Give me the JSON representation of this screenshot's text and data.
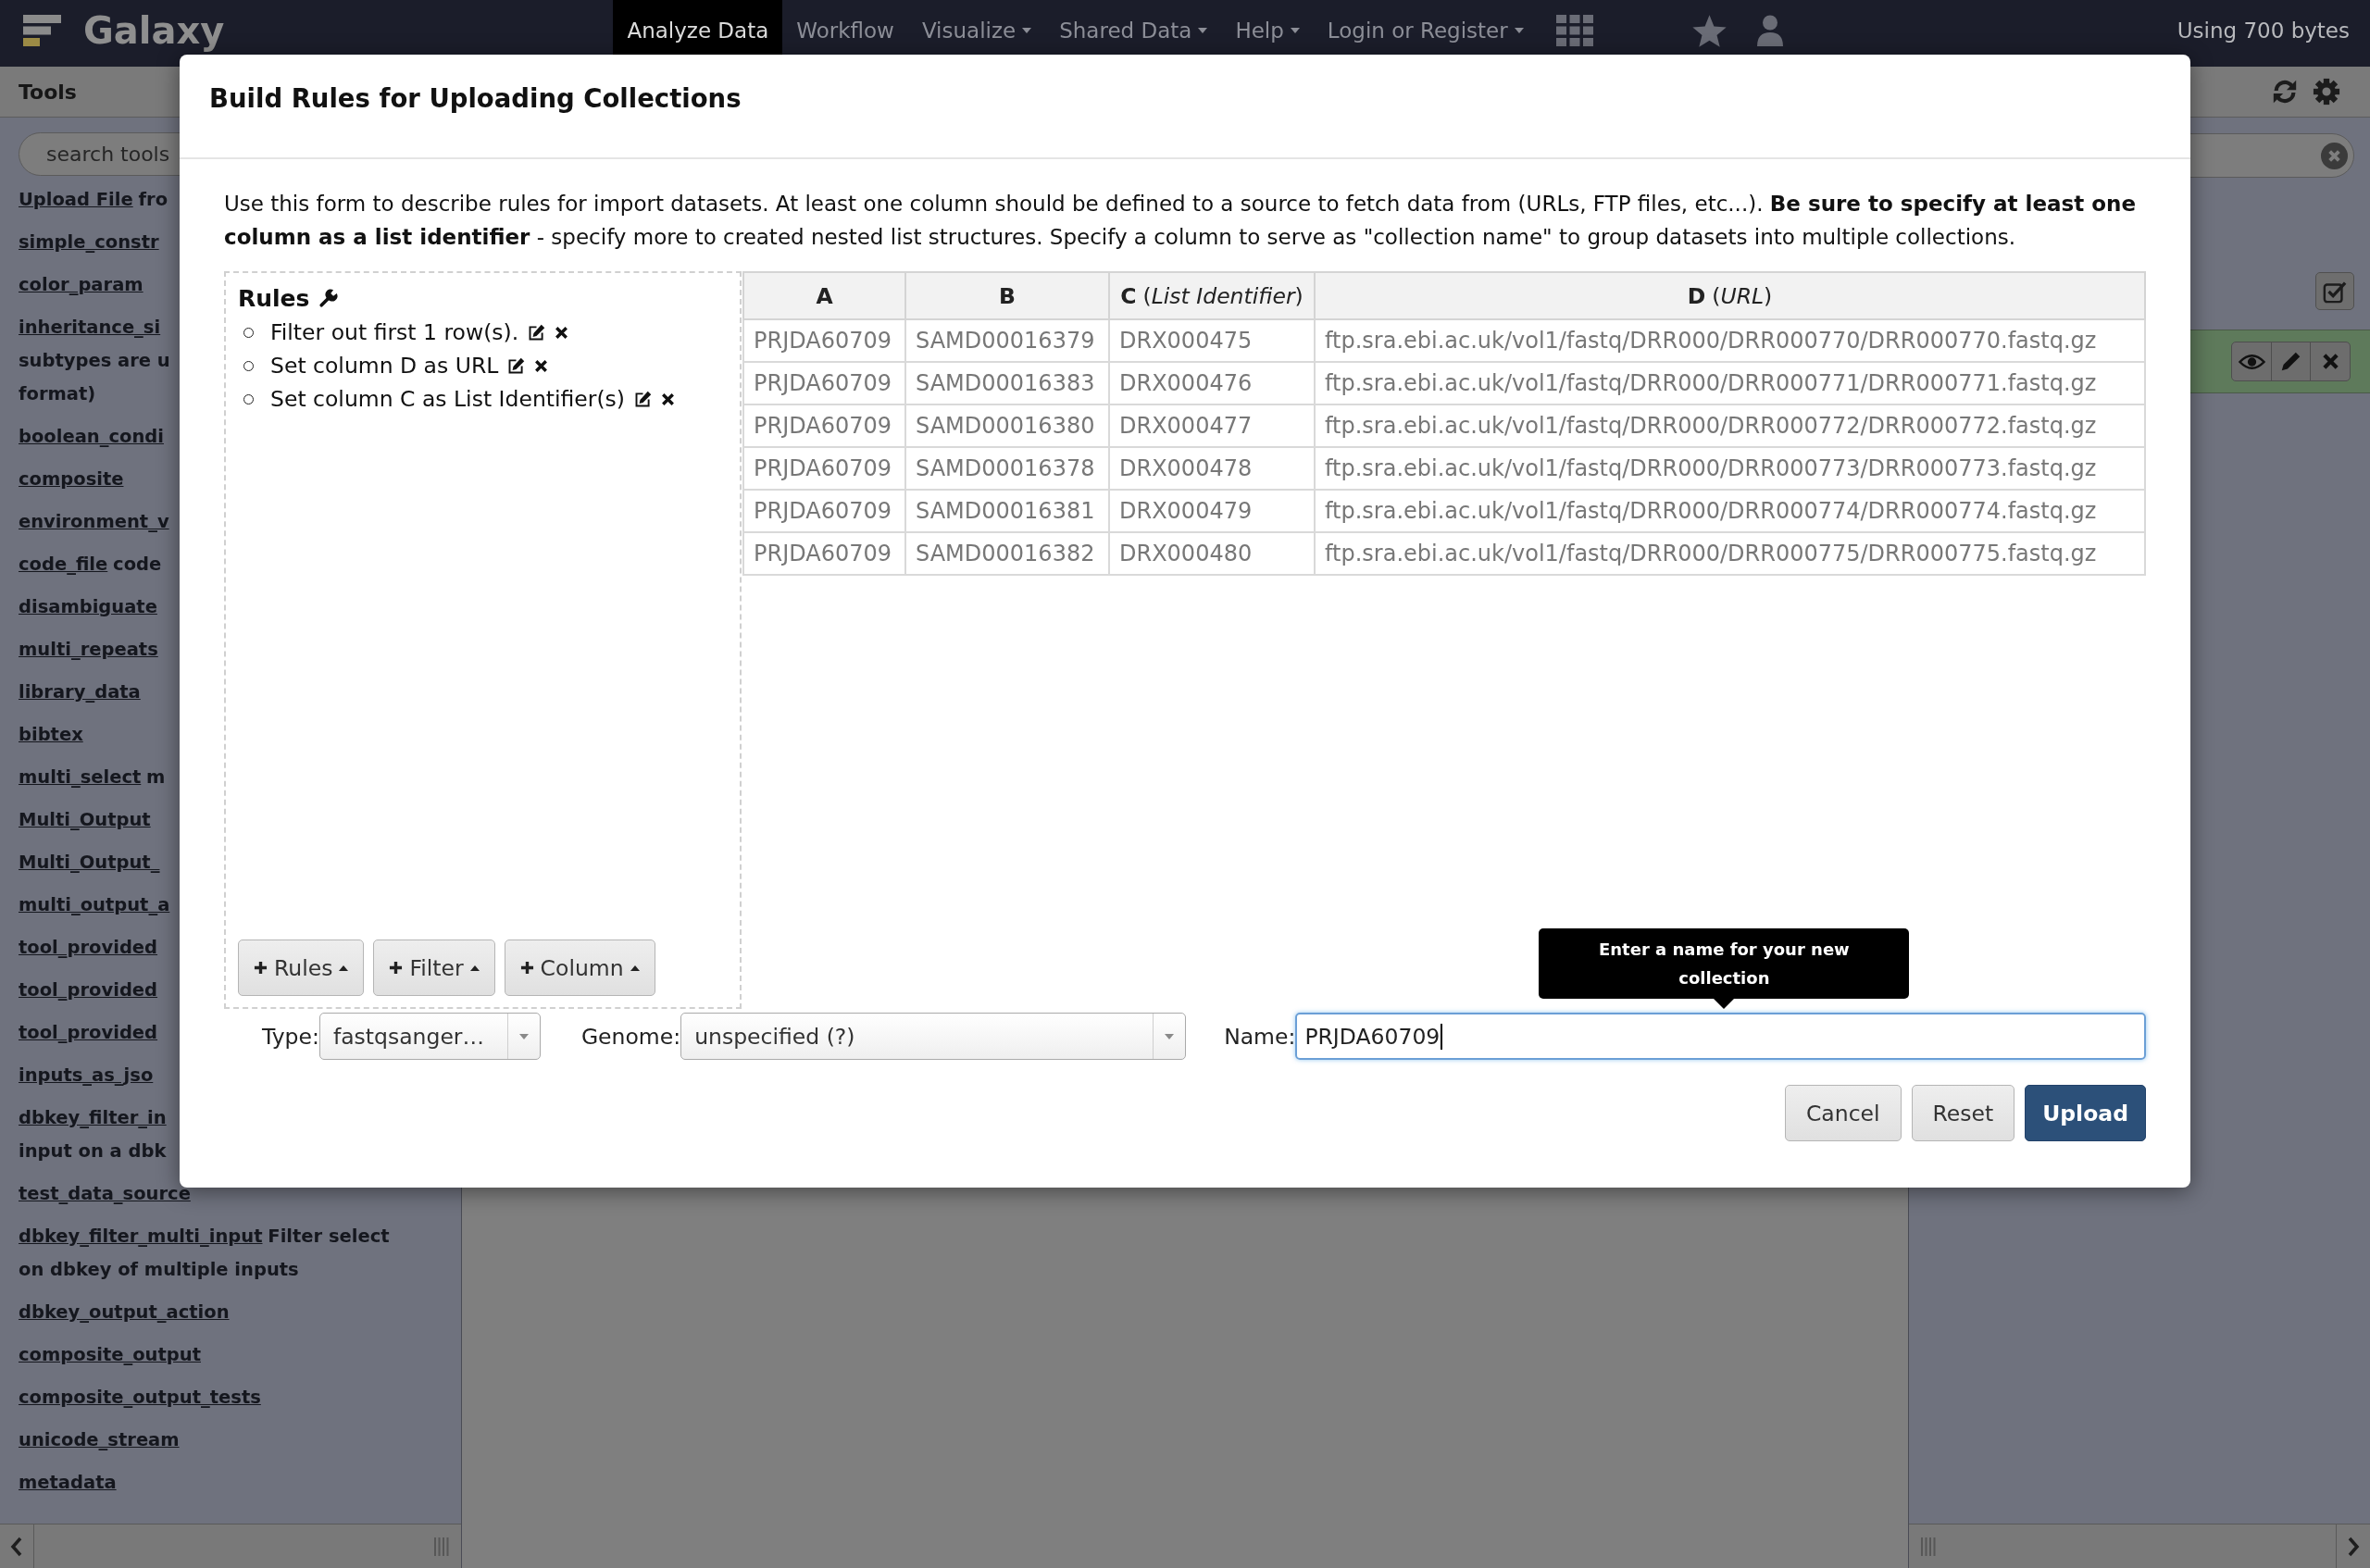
{
  "navbar": {
    "brand": "Galaxy",
    "tabs": [
      {
        "label": "Analyze Data",
        "selected": true,
        "dropdown": false
      },
      {
        "label": "Workflow",
        "selected": false,
        "dropdown": false
      },
      {
        "label": "Visualize",
        "selected": false,
        "dropdown": true
      },
      {
        "label": "Shared Data",
        "selected": false,
        "dropdown": true
      },
      {
        "label": "Help",
        "selected": false,
        "dropdown": true
      },
      {
        "label": "Login or Register",
        "selected": false,
        "dropdown": true
      }
    ],
    "quota": "Using 700 bytes"
  },
  "tool_panel": {
    "title": "Tools",
    "search": {
      "placeholder": "search tools"
    },
    "tools": [
      {
        "name": "Upload File",
        "description": "fro"
      },
      {
        "name": "simple_constr"
      },
      {
        "name": "color_param"
      },
      {
        "name": "inheritance_si",
        "continued_lines": [
          "subtypes are u",
          "format)"
        ]
      },
      {
        "name": "boolean_condi"
      },
      {
        "name": "composite"
      },
      {
        "name": "environment_v"
      },
      {
        "name": "code_file",
        "description": "code"
      },
      {
        "name": "disambiguate"
      },
      {
        "name": "multi_repeats"
      },
      {
        "name": "library_data"
      },
      {
        "name": "bibtex"
      },
      {
        "name": "multi_select",
        "description": "m"
      },
      {
        "name": "Multi_Output"
      },
      {
        "name": "Multi_Output_"
      },
      {
        "name": "multi_output_a"
      },
      {
        "name": "tool_provided"
      },
      {
        "name": "tool_provided"
      },
      {
        "name": "tool_provided"
      },
      {
        "name": "inputs_as_jso"
      },
      {
        "name": "dbkey_filter_in",
        "continued_lines": [
          "input on a dbk"
        ]
      },
      {
        "name": "test_data_source"
      },
      {
        "name": "dbkey_filter_multi_input",
        "description": "Filter select on dbkey of multiple inputs"
      },
      {
        "name": "dbkey_output_action"
      },
      {
        "name": "composite_output"
      },
      {
        "name": "composite_output_tests"
      },
      {
        "name": "unicode_stream"
      },
      {
        "name": "metadata"
      }
    ]
  },
  "modal": {
    "title": "Build Rules for Uploading Collections",
    "intro": "Use this form to describe rules for import datasets. At least one column should be defined to a source to fetch data from (URLs, FTP files, etc...). **Be sure to specify at least one column as a list identifier** - specify more to created nested list structures. Specify a column to serve as \"collection name\" to group datasets into multiple collections.",
    "rules": {
      "title": "Rules",
      "items": [
        "Filter out first 1 row(s).",
        "Set column D as URL",
        "Set column C as List Identifier(s)"
      ],
      "menu_buttons": [
        "Rules",
        "Filter",
        "Column"
      ]
    },
    "table": {
      "columns": [
        {
          "letter": "A"
        },
        {
          "letter": "B"
        },
        {
          "letter": "C",
          "detail": "(*List Identifier*)"
        },
        {
          "letter": "D",
          "detail": "(*URL*)"
        }
      ],
      "rows": [
        [
          "PRJDA60709",
          "SAMD00016379",
          "DRX000475",
          "ftp.sra.ebi.ac.uk/vol1/fastq/DRR000/DRR000770/DRR000770.fastq.gz"
        ],
        [
          "PRJDA60709",
          "SAMD00016383",
          "DRX000476",
          "ftp.sra.ebi.ac.uk/vol1/fastq/DRR000/DRR000771/DRR000771.fastq.gz"
        ],
        [
          "PRJDA60709",
          "SAMD00016380",
          "DRX000477",
          "ftp.sra.ebi.ac.uk/vol1/fastq/DRR000/DRR000772/DRR000772.fastq.gz"
        ],
        [
          "PRJDA60709",
          "SAMD00016378",
          "DRX000478",
          "ftp.sra.ebi.ac.uk/vol1/fastq/DRR000/DRR000773/DRR000773.fastq.gz"
        ],
        [
          "PRJDA60709",
          "SAMD00016381",
          "DRX000479",
          "ftp.sra.ebi.ac.uk/vol1/fastq/DRR000/DRR000774/DRR000774.fastq.gz"
        ],
        [
          "PRJDA60709",
          "SAMD00016382",
          "DRX000480",
          "ftp.sra.ebi.ac.uk/vol1/fastq/DRR000/DRR000775/DRR000775.fastq.gz"
        ]
      ]
    },
    "fields": [
      {
        "kind": "select",
        "label": "Type:",
        "value": "fastqsanger…"
      },
      {
        "kind": "select",
        "label": "Genome:",
        "value": "unspecified (?)"
      },
      {
        "kind": "text",
        "label": "Name:",
        "value": "PRJDA60709",
        "focused": true,
        "tooltip": "Enter a name for your new collection"
      }
    ],
    "buttons": [
      {
        "label": "Cancel",
        "kind": "default"
      },
      {
        "label": "Reset",
        "kind": "default"
      },
      {
        "label": "Upload",
        "kind": "primary"
      }
    ]
  }
}
